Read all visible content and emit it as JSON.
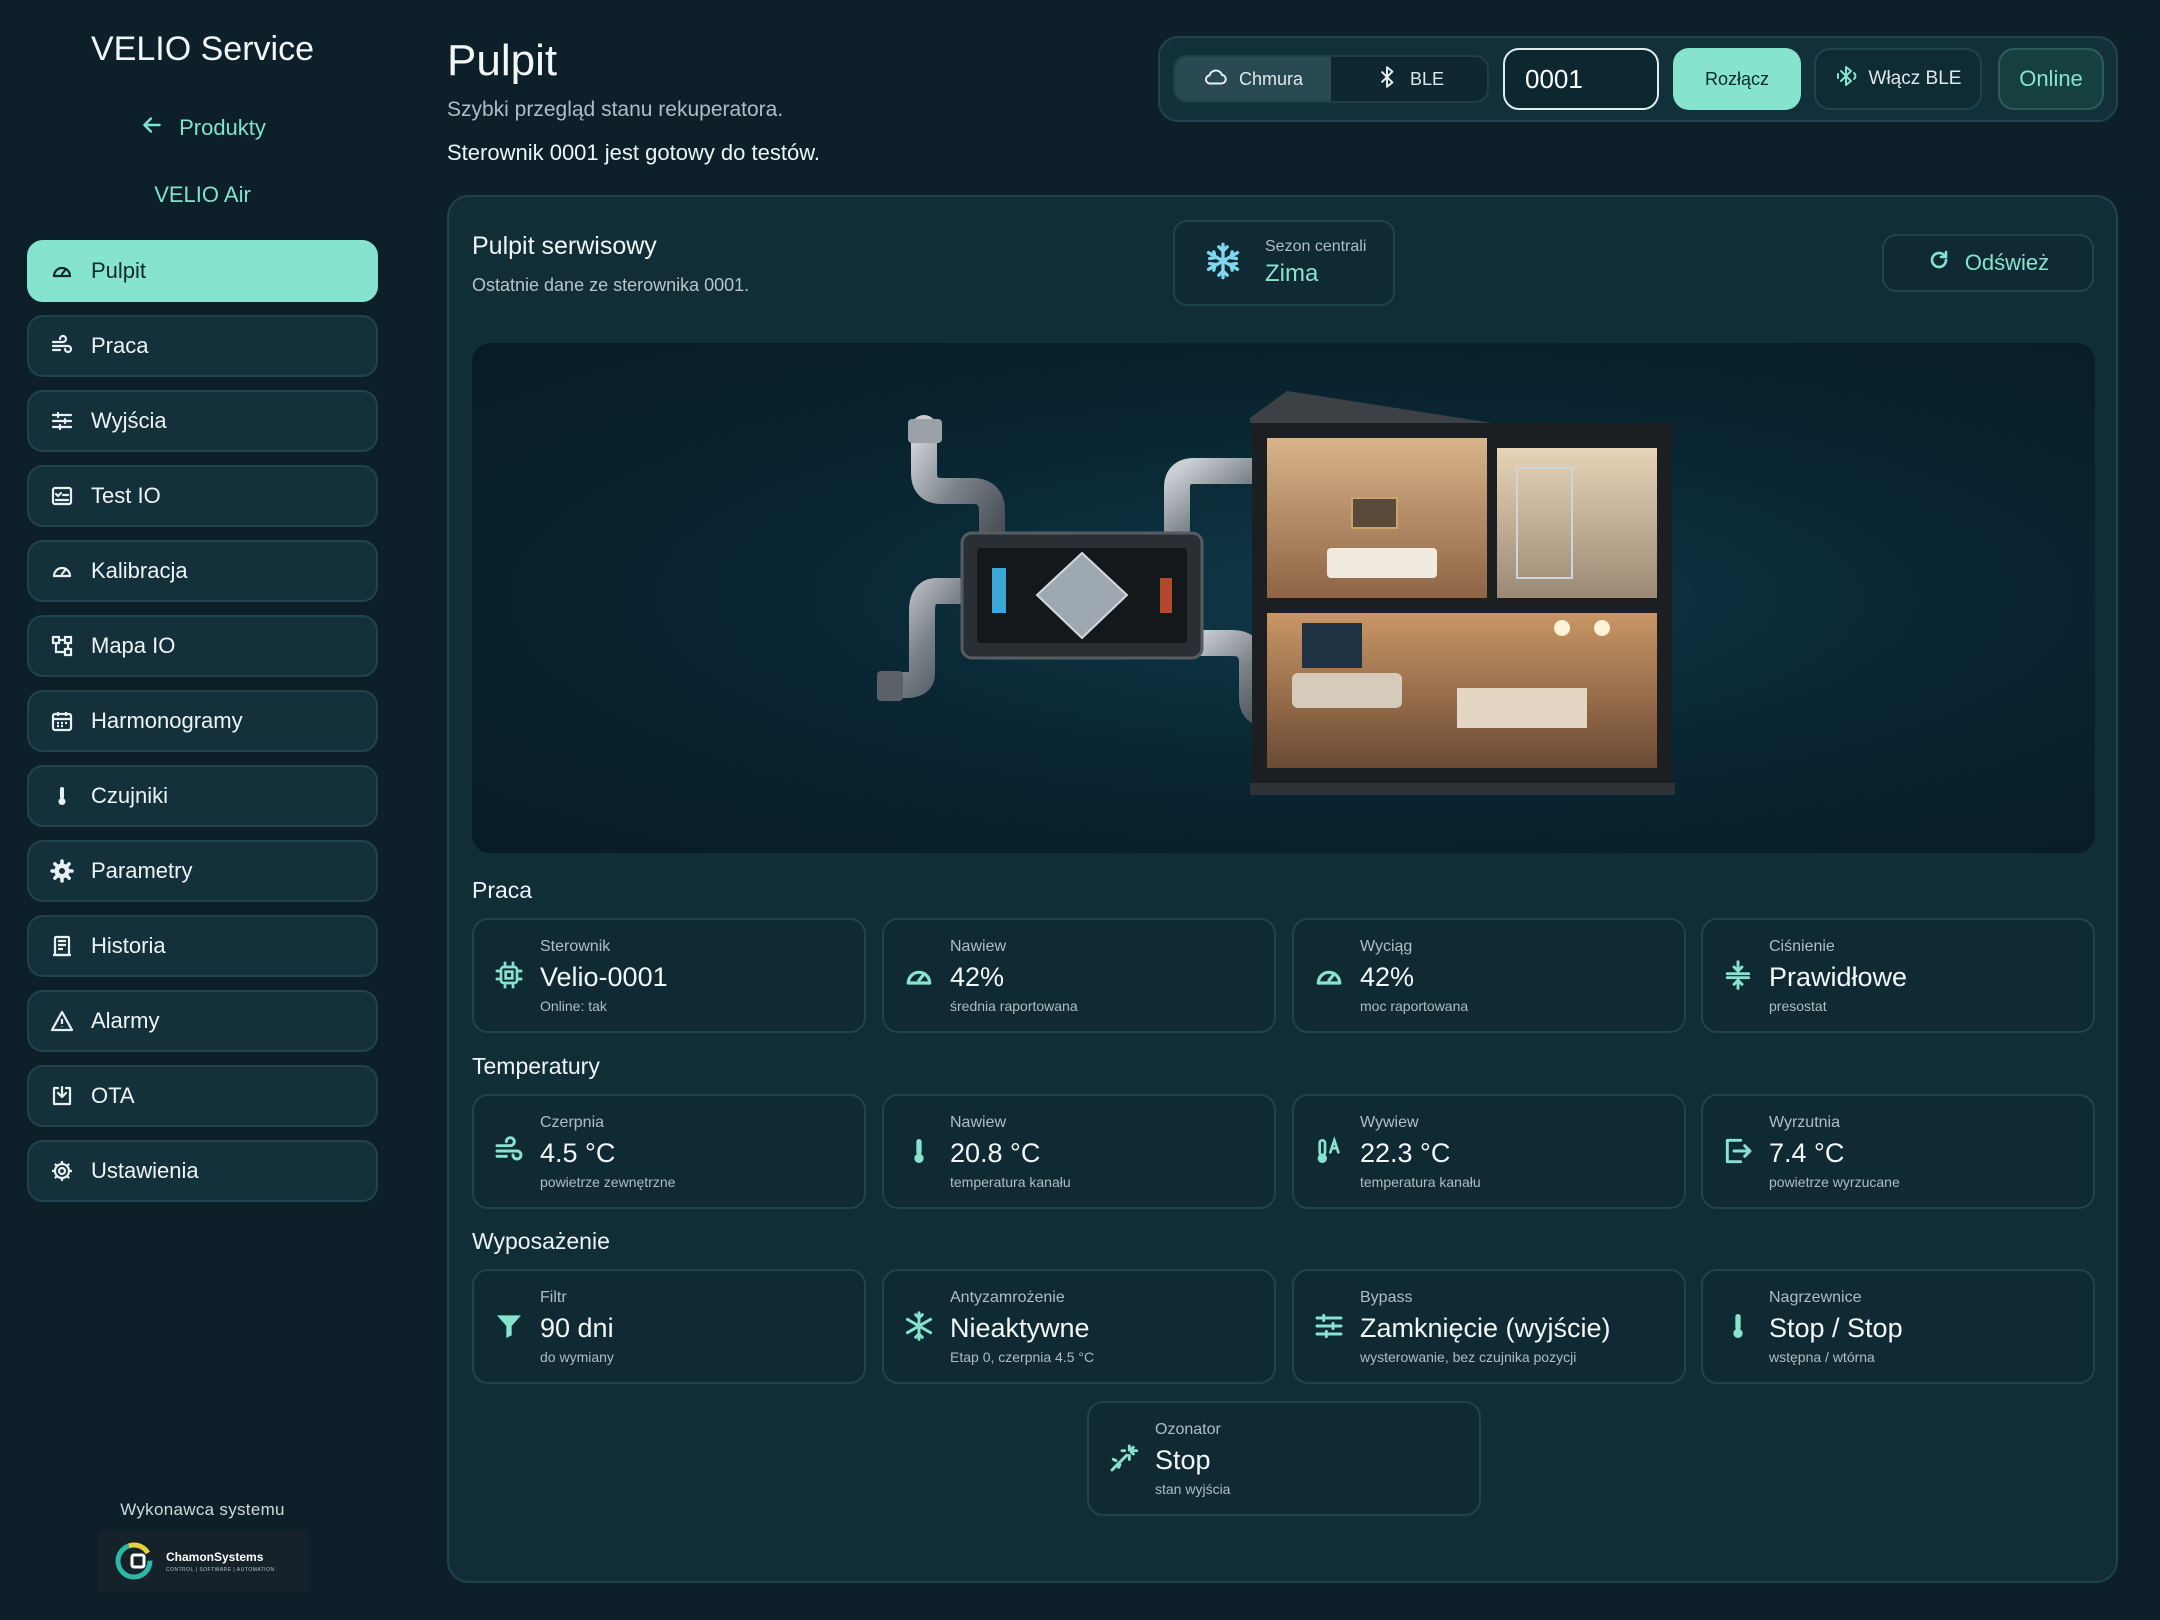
{
  "app": {
    "brand": "VELIO Service",
    "back_label": "Produkty",
    "product": "VELIO Air",
    "made_by_label": "Wykonawca systemu",
    "logo_name": "ChamonSystems",
    "logo_tagline": "CONTROL | SOFTWARE | AUTOMATION"
  },
  "sidebar": {
    "items": [
      {
        "label": "Pulpit",
        "icon": "gauge-icon",
        "active": true
      },
      {
        "label": "Praca",
        "icon": "fan-icon"
      },
      {
        "label": "Wyjścia",
        "icon": "sliders-icon"
      },
      {
        "label": "Test IO",
        "icon": "checklist-icon"
      },
      {
        "label": "Kalibracja",
        "icon": "gauge-icon"
      },
      {
        "label": "Mapa IO",
        "icon": "map-icon"
      },
      {
        "label": "Harmonogramy",
        "icon": "calendar-icon"
      },
      {
        "label": "Czujniki",
        "icon": "thermometer-icon"
      },
      {
        "label": "Parametry",
        "icon": "gear-icon"
      },
      {
        "label": "Historia",
        "icon": "history-icon"
      },
      {
        "label": "Alarmy",
        "icon": "warning-icon"
      },
      {
        "label": "OTA",
        "icon": "download-icon"
      },
      {
        "label": "Ustawienia",
        "icon": "settings-icon"
      }
    ]
  },
  "header": {
    "title": "Pulpit",
    "subtitle": "Szybki przegląd stanu rekuperatora.",
    "status": "Sterownik 0001 jest gotowy do testów."
  },
  "connection": {
    "cloud_label": "Chmura",
    "ble_label": "BLE",
    "controller_id": "0001",
    "disconnect_label": "Rozłącz",
    "enable_ble_label": "Włącz BLE",
    "status": "Online"
  },
  "panel": {
    "title": "Pulpit serwisowy",
    "subtitle": "Ostatnie dane ze sterownika 0001.",
    "season_label": "Sezon centrali",
    "season_value": "Zima",
    "refresh_label": "Odśwież"
  },
  "sections": {
    "work": {
      "title": "Praca",
      "cards": [
        {
          "label": "Sterownik",
          "value": "Velio-0001",
          "note": "Online: tak",
          "icon": "chip-icon"
        },
        {
          "label": "Nawiew",
          "value": "42%",
          "note": "średnia raportowana",
          "icon": "gauge-icon"
        },
        {
          "label": "Wyciąg",
          "value": "42%",
          "note": "moc raportowana",
          "icon": "gauge-icon"
        },
        {
          "label": "Ciśnienie",
          "value": "Prawidłowe",
          "note": "presostat",
          "icon": "pressure-icon"
        }
      ]
    },
    "temps": {
      "title": "Temperatury",
      "cards": [
        {
          "label": "Czerpnia",
          "value": "4.5 °C",
          "note": "powietrze zewnętrzne",
          "icon": "wind-icon"
        },
        {
          "label": "Nawiew",
          "value": "20.8 °C",
          "note": "temperatura kanału",
          "icon": "thermometer-icon"
        },
        {
          "label": "Wywiew",
          "value": "22.3 °C",
          "note": "temperatura kanału",
          "icon": "thermometer-auto-icon"
        },
        {
          "label": "Wyrzutnia",
          "value": "7.4 °C",
          "note": "powietrze wyrzucane",
          "icon": "exit-icon"
        }
      ]
    },
    "equipment": {
      "title": "Wyposażenie",
      "cards": [
        {
          "label": "Filtr",
          "value": "90 dni",
          "note": "do wymiany",
          "icon": "filter-icon"
        },
        {
          "label": "Antyzamrożenie",
          "value": "Nieaktywne",
          "note": "Etap 0, czerpnia 4.5 °C",
          "icon": "snowflake-icon"
        },
        {
          "label": "Bypass",
          "value": "Zamknięcie (wyjście)",
          "note": "wysterowanie, bez czujnika pozycji",
          "icon": "sliders-icon"
        },
        {
          "label": "Nagrzewnice",
          "value": "Stop / Stop",
          "note": "wstępna / wtórna",
          "icon": "thermometer-icon"
        },
        {
          "label": "Ozonator",
          "value": "Stop",
          "note": "stan wyjścia",
          "icon": "wand-icon"
        }
      ]
    }
  },
  "colors": {
    "accent": "#86e3cd",
    "background": "#0d2029",
    "card": "#0f2a33",
    "border": "#21434e"
  }
}
